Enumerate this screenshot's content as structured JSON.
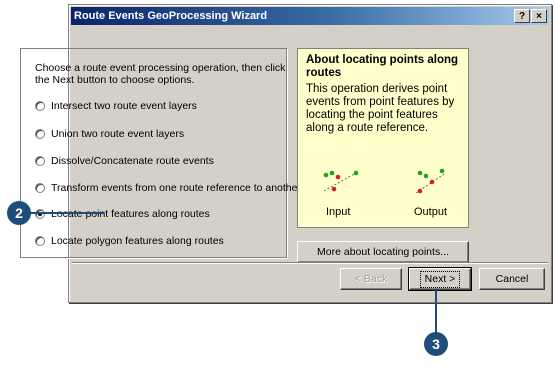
{
  "window": {
    "title": "Route Events GeoProcessing Wizard",
    "help_glyph": "?",
    "close_glyph": "×"
  },
  "instructions": "Choose a route event processing operation, then click the Next button to choose options.",
  "options": [
    {
      "label": "Intersect two route event layers",
      "checked": false
    },
    {
      "label": "Union two route event layers",
      "checked": false
    },
    {
      "label": "Dissolve/Concatenate route events",
      "checked": false
    },
    {
      "label": "Transform events from one route reference to another",
      "checked": false
    },
    {
      "label": "Locate point features along routes",
      "checked": true
    },
    {
      "label": "Locate polygon features along routes",
      "checked": false
    }
  ],
  "info": {
    "title": "About locating points along routes",
    "body": "This operation derives point events from point features by locating the point features along a route reference.",
    "input_label": "Input",
    "output_label": "Output",
    "more_button": "More about locating points...",
    "panel_color": "#ffffcc"
  },
  "buttons": {
    "back": "< Back",
    "next": "Next >",
    "cancel": "Cancel"
  },
  "callouts": {
    "step_a": "2",
    "step_b": "3",
    "color": "#1f4d7a"
  }
}
